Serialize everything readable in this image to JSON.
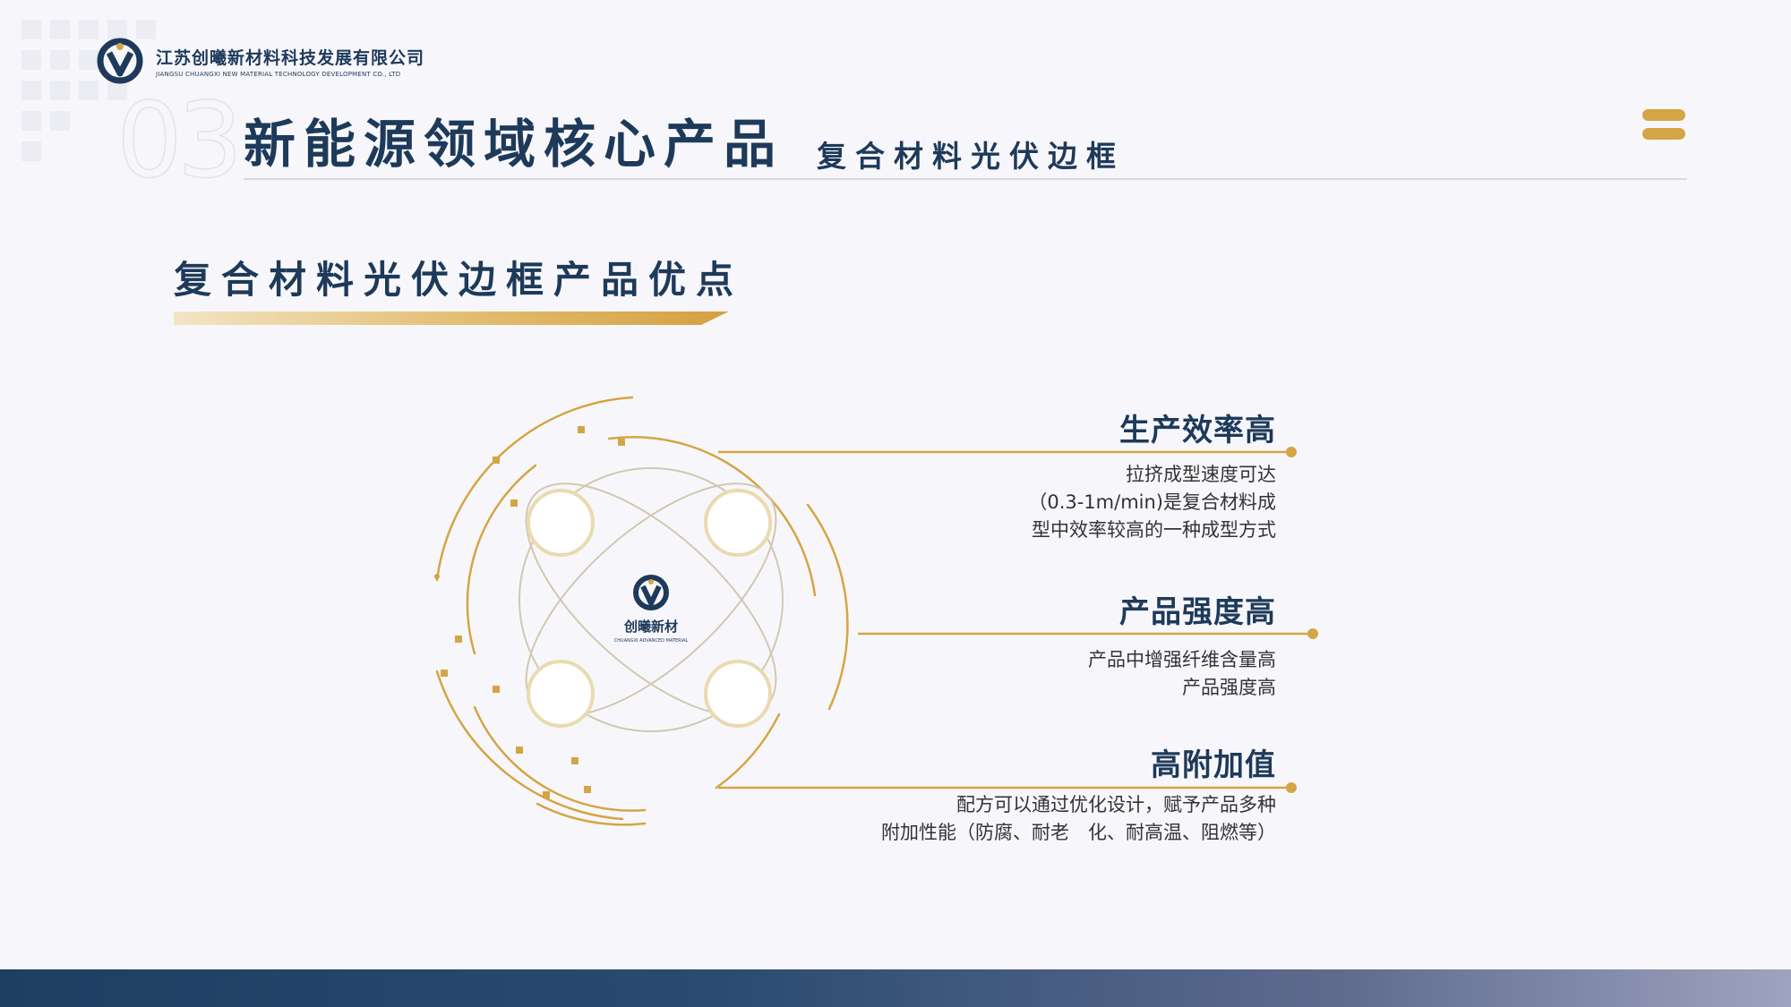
{
  "company": {
    "name_cn": "江苏创曦新材料科技发展有限公司",
    "name_en": "JIANGSU CHUANGXI NEW MATERIAL TECHNOLOGY DEVELOPMENT CO., LTD"
  },
  "header": {
    "section_number": "03",
    "title": "新能源领域核心产品",
    "subtitle": "复合材料光伏边框"
  },
  "section": {
    "title": "复合材料光伏边框产品优点"
  },
  "diagram": {
    "center_label": "创曦新材",
    "center_sublabel": "CHUANGXI ADVANCED MATERIAL"
  },
  "features": [
    {
      "title": "生产效率高",
      "lines": [
        "拉挤成型速度可达",
        "（0.3-1m/min)是复合材料成",
        "型中效率较高的一种成型方式"
      ]
    },
    {
      "title": "产品强度高",
      "lines": [
        "产品中增强纤维含量高",
        "产品强度高"
      ]
    },
    {
      "title": "高附加值",
      "lines": [
        "配方可以通过优化设计，赋予产品多种",
        "附加性能（防腐、耐老　化、耐高温、阻燃等）"
      ]
    }
  ],
  "colors": {
    "navy": "#1e3a5a",
    "gold": "#d4a545"
  }
}
